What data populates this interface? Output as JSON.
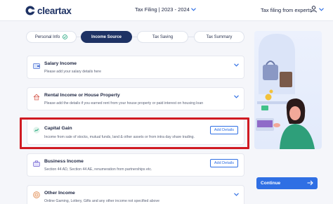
{
  "header": {
    "logo_text": "cleartax",
    "fy_label": "Tax Filing | 2023 - 2024",
    "filing_link": "Tax filing from experts"
  },
  "stepper": {
    "steps": [
      {
        "label": "Personal Info",
        "state": "completed"
      },
      {
        "label": "Income Source",
        "state": "active"
      },
      {
        "label": "Tax Saving",
        "state": "pending"
      },
      {
        "label": "Tax Summary",
        "state": "pending"
      }
    ]
  },
  "income_sources": [
    {
      "title": "Salary Income",
      "description": "Please add your salary details here",
      "icon": "wallet-icon",
      "action": "expand"
    },
    {
      "title": "Rental Income or House Property",
      "description": "Please add the details if you earned rent from your house property or paid interest on housing loan",
      "icon": "house-icon",
      "action": "expand"
    },
    {
      "title": "Capital Gain",
      "description": "Income from sale of stocks, mutual funds, land & other assets or from intra day share trading.",
      "icon": "chart-icon",
      "action": "Add Details"
    },
    {
      "title": "Business Income",
      "description": "Section 44 AD, Section 44 AE, renumeration from partnerships etc.",
      "icon": "briefcase-icon",
      "action": "Add Details"
    },
    {
      "title": "Other Income",
      "description": "Online Gaming, Lottery, Gifts and any other income not specified above",
      "icon": "coins-icon",
      "action": "expand"
    }
  ],
  "continue_label": "Continue",
  "colors": {
    "brand_navy": "#1e3264",
    "primary_blue": "#2f6fe4",
    "highlight_red": "#d01a22",
    "background": "#f5f6fa"
  }
}
